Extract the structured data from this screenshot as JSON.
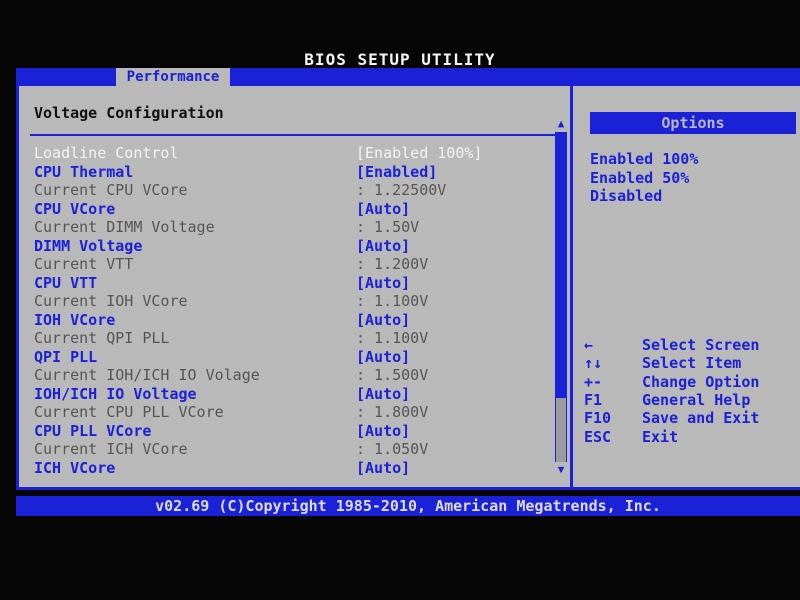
{
  "title": "BIOS SETUP UTILITY",
  "tab": "Performance",
  "section_title": "Voltage Configuration",
  "rows": [
    {
      "label": "Loadline Control",
      "value": "[Enabled 100%]",
      "kind": "highlight"
    },
    {
      "label": "CPU Thermal",
      "value": "[Enabled]",
      "kind": "setting"
    },
    {
      "label": "Current CPU VCore",
      "value": ": 1.22500V",
      "kind": "info"
    },
    {
      "label": "CPU VCore",
      "value": "[Auto]",
      "kind": "setting"
    },
    {
      "label": "Current DIMM Voltage",
      "value": ": 1.50V",
      "kind": "info"
    },
    {
      "label": "DIMM Voltage",
      "value": "[Auto]",
      "kind": "setting"
    },
    {
      "label": "Current VTT",
      "value": ": 1.200V",
      "kind": "info"
    },
    {
      "label": "CPU VTT",
      "value": "[Auto]",
      "kind": "setting"
    },
    {
      "label": "Current IOH VCore",
      "value": ": 1.100V",
      "kind": "info"
    },
    {
      "label": "IOH VCore",
      "value": "[Auto]",
      "kind": "setting"
    },
    {
      "label": "Current QPI PLL",
      "value": ": 1.100V",
      "kind": "info"
    },
    {
      "label": "QPI PLL",
      "value": "[Auto]",
      "kind": "setting"
    },
    {
      "label": "Current IOH/ICH IO Volage",
      "value": ": 1.500V",
      "kind": "info"
    },
    {
      "label": "IOH/ICH IO Voltage",
      "value": "[Auto]",
      "kind": "setting"
    },
    {
      "label": "Current CPU PLL VCore",
      "value": ": 1.800V",
      "kind": "info"
    },
    {
      "label": "CPU PLL VCore",
      "value": "[Auto]",
      "kind": "setting"
    },
    {
      "label": "Current ICH VCore",
      "value": ": 1.050V",
      "kind": "info"
    },
    {
      "label": "ICH VCore",
      "value": "[Auto]",
      "kind": "setting"
    }
  ],
  "options_header": "Options",
  "options": [
    "Enabled 100%",
    "Enabled 50%",
    "Disabled"
  ],
  "help": [
    {
      "key": "←",
      "desc": "Select Screen"
    },
    {
      "key": "↑↓",
      "desc": "Select Item"
    },
    {
      "key": "+-",
      "desc": "Change Option"
    },
    {
      "key": "F1",
      "desc": "General Help"
    },
    {
      "key": "F10",
      "desc": "Save and Exit"
    },
    {
      "key": "ESC",
      "desc": "Exit"
    }
  ],
  "footer": "v02.69 (C)Copyright 1985-2010, American Megatrends, Inc.",
  "colors": {
    "bios_blue": "#1a21d6",
    "panel_gray": "#b9b9b9",
    "highlight_white": "#f4f4f4"
  },
  "scrollbar_icons": {
    "up": "triangle-up-icon",
    "down": "triangle-down-icon"
  }
}
